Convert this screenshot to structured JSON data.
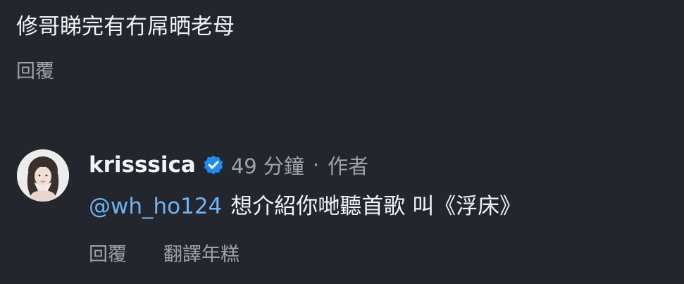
{
  "parent_comment": {
    "text": "修哥睇完有冇屌晒老母",
    "reply_label": "回覆"
  },
  "reply_comment": {
    "username": "krisssica",
    "verified_icon": "verified-badge-icon",
    "time": "49 分鐘",
    "separator": "·",
    "author_tag": "作者",
    "mention": "@wh_ho124",
    "body": "想介紹你哋聽首歌 叫《浮床》",
    "reply_label": "回覆",
    "translate_label": "翻譯年糕"
  },
  "colors": {
    "background": "#24262e",
    "text": "#f2f3f5",
    "muted": "#9fa2aa",
    "mention": "#6db5f5",
    "verified": "#1d8cf0"
  }
}
